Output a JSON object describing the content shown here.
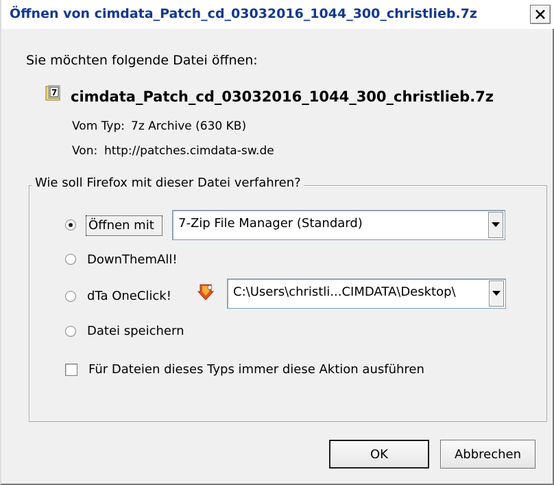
{
  "window": {
    "title": "Öffnen von cimdata_Patch_cd_03032016_1044_300_christlieb.7z"
  },
  "dialog": {
    "prompt": "Sie möchten folgende Datei öffnen:",
    "file_name": "cimdata_Patch_cd_03032016_1044_300_christlieb.7z",
    "type_label": "Vom Typ:",
    "type_value": "7z Archive (630 KB)",
    "from_label": "Von:",
    "from_value": "http://patches.cimdata-sw.de"
  },
  "action_group": {
    "legend": "Wie soll Firefox mit dieser Datei verfahren?",
    "options": [
      {
        "label": "Öffnen mit",
        "selected": true
      },
      {
        "label": "DownThemAll!",
        "selected": false
      },
      {
        "label": "dTa OneClick!",
        "selected": false
      },
      {
        "label": "Datei speichern",
        "selected": false
      }
    ],
    "open_with_value": "7-Zip File Manager (Standard)",
    "oneclick_path": "C:\\Users\\christli...CIMDATA\\Desktop\\",
    "always_label": "Für Dateien dieses Typs immer diese Aktion ausführen",
    "always_checked": false
  },
  "buttons": {
    "ok": "OK",
    "cancel": "Abbrechen"
  },
  "icons": {
    "close": "close-icon",
    "file": "file-icon",
    "dta": "dta-oneclick-icon",
    "dropdown": "dropdown-arrow-icon"
  }
}
